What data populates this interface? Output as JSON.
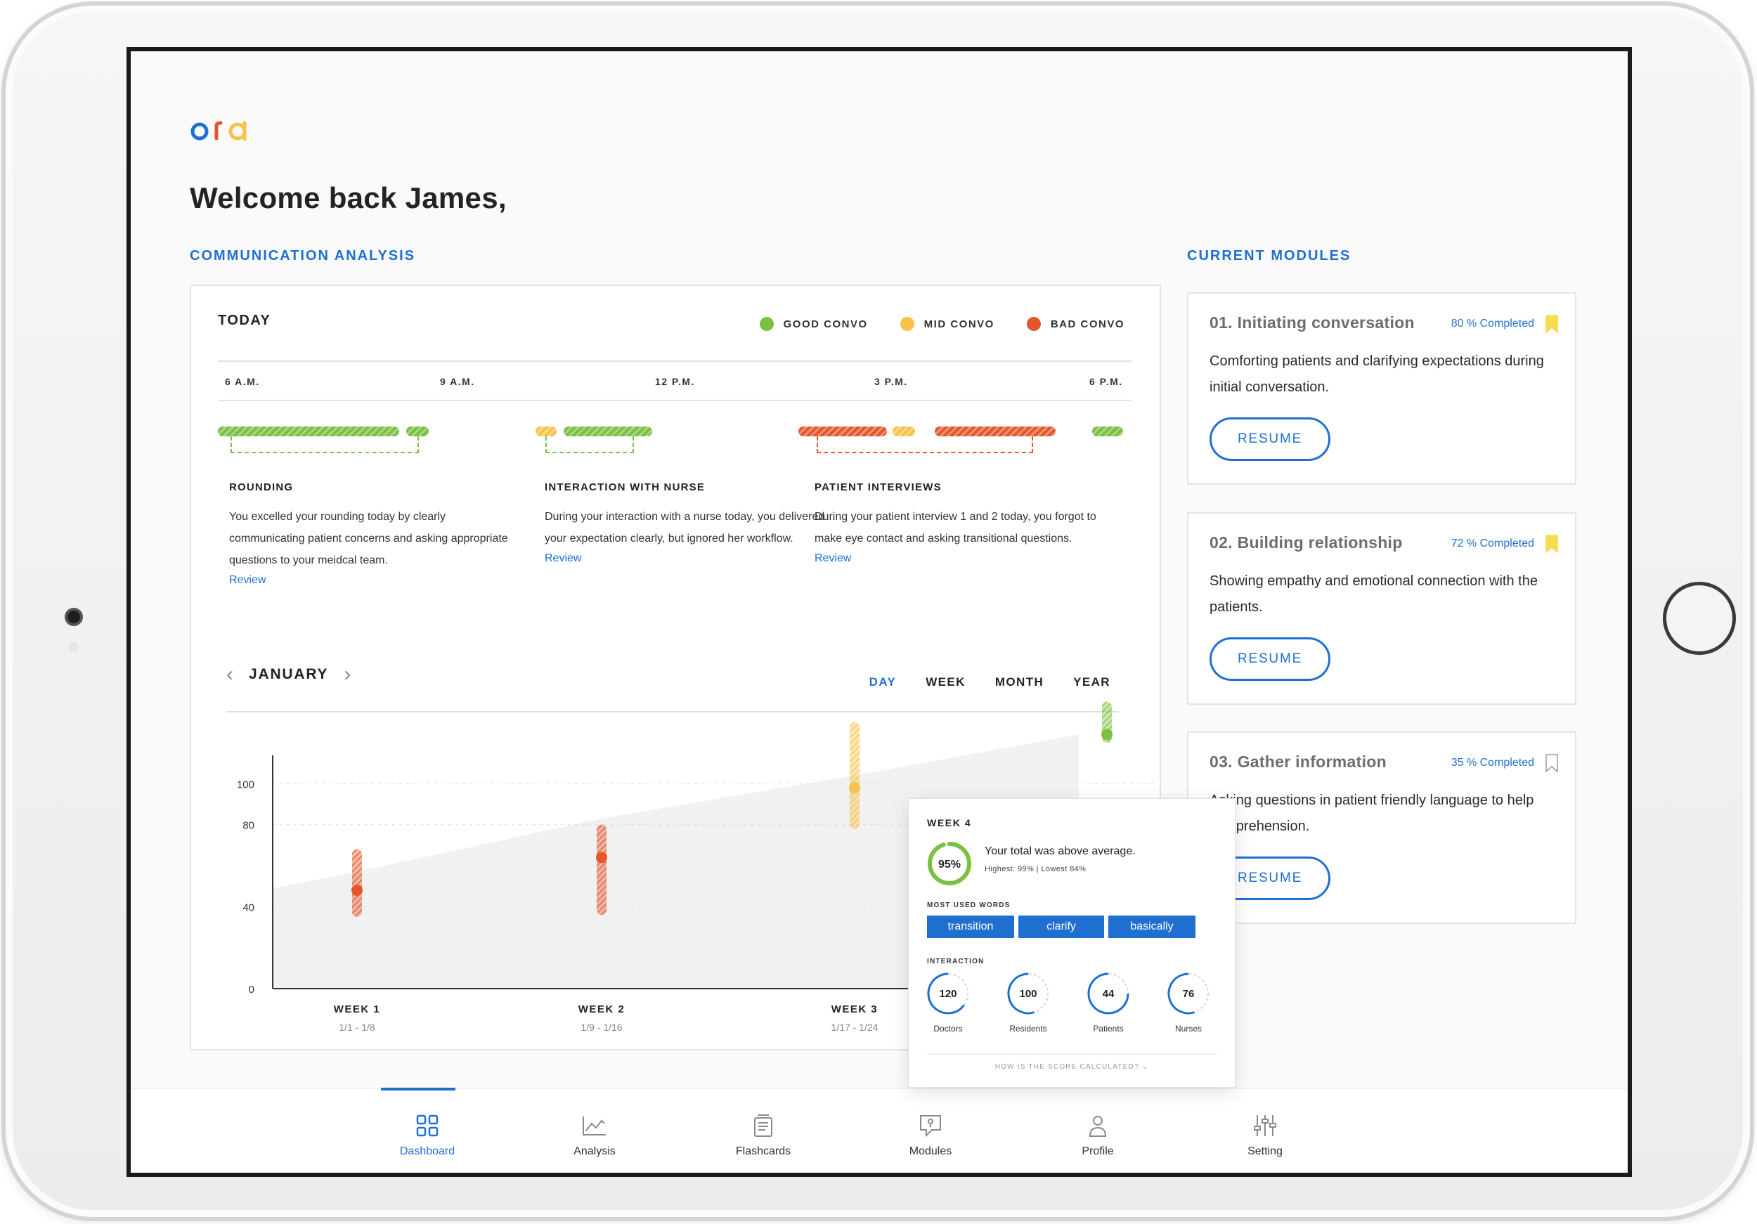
{
  "brand": {
    "logo": "ora",
    "logo_colors": [
      "#1f6fd1",
      "#e3572a",
      "#f6c24b"
    ]
  },
  "header": {
    "welcome": "Welcome back James,"
  },
  "sections": {
    "analysis": "COMMUNICATION ANALYSIS",
    "modules": "CURRENT MODULES"
  },
  "today": {
    "label": "TODAY",
    "legend": [
      {
        "label": "GOOD CONVO",
        "color": "#79c043"
      },
      {
        "label": "MID CONVO",
        "color": "#f6c24b"
      },
      {
        "label": "BAD CONVO",
        "color": "#e3572a"
      }
    ],
    "ticks": [
      "6 A.M.",
      "9 A.M.",
      "12 P.M.",
      "3 P.M.",
      "6 P.M."
    ],
    "events": [
      {
        "title": "ROUNDING",
        "text": "You excelled your rounding today by clearly communicating patient concerns and asking appropriate questions to your meidcal team.",
        "link": "Review"
      },
      {
        "title": "INTERACTION WITH NURSE",
        "text": "During your interaction with a nurse today, you delivered your expectation clearly, but ignored her workflow.",
        "link": "Review"
      },
      {
        "title": "PATIENT INTERVIEWS",
        "text": "During your patient interview 1 and 2 today, you forgot to make eye contact and asking transitional questions.",
        "link": "Review"
      }
    ]
  },
  "period": {
    "month": "JANUARY",
    "tabs": [
      "DAY",
      "WEEK",
      "MONTH",
      "YEAR"
    ],
    "active_tab": "DAY"
  },
  "chart_data": {
    "type": "line",
    "categories": [
      "WEEK 1",
      "WEEK 2",
      "WEEK 3",
      "WEEK 4"
    ],
    "date_ranges": [
      "1/1 - 1/8",
      "1/9 - 1/16",
      "1/17 - 1/24",
      ""
    ],
    "y_ticks": [
      0,
      40,
      80,
      100
    ],
    "ylim": [
      0,
      120
    ],
    "values": [
      48,
      64,
      98,
      124
    ],
    "ranges": [
      [
        35,
        68
      ],
      [
        36,
        80
      ],
      [
        78,
        130
      ],
      [
        120,
        140
      ]
    ],
    "point_colors": [
      "#e3572a",
      "#e3572a",
      "#f6c24b",
      "#79c043"
    ],
    "average_area": [
      49,
      57,
      83,
      104,
      124
    ]
  },
  "popover": {
    "week": "WEEK 4",
    "score": "95%",
    "score_value": 95,
    "summary": "Your total was above average.",
    "range": "Highest: 99%  |  Lowest 84%",
    "words_label": "MOST USED WORDS",
    "words": [
      "transition",
      "clarify",
      "basically"
    ],
    "interaction_label": "INTERACTION",
    "interactions": [
      {
        "count": "120",
        "label": "Doctors",
        "fill": 0.35
      },
      {
        "count": "100",
        "label": "Residents",
        "fill": 0.45
      },
      {
        "count": "44",
        "label": "Patients",
        "fill": 0.25
      },
      {
        "count": "76",
        "label": "Nurses",
        "fill": 0.45
      }
    ],
    "footer": "HOW IS THE SCORE CALCULATED?"
  },
  "modules": [
    {
      "title": "01. Initiating conversation",
      "progress": "80 % Completed",
      "bookmarked": true,
      "desc": "Comforting patients and clarifying expectations during initial conversation.",
      "button": "RESUME"
    },
    {
      "title": "02. Building relationship",
      "progress": "72 % Completed",
      "bookmarked": true,
      "desc": "Showing empathy and emotional connection with the patients.",
      "button": "RESUME"
    },
    {
      "title": "03. Gather information",
      "progress": "35 % Completed",
      "bookmarked": false,
      "desc": "Asking questions in patient friendly language to help comprehension.",
      "button": "RESUME"
    }
  ],
  "nav": {
    "items": [
      {
        "label": "Dashboard",
        "icon": "grid-icon"
      },
      {
        "label": "Analysis",
        "icon": "chart-icon"
      },
      {
        "label": "Flashcards",
        "icon": "flashcards-icon"
      },
      {
        "label": "Modules",
        "icon": "modules-icon"
      },
      {
        "label": "Profile",
        "icon": "profile-icon"
      },
      {
        "label": "Setting",
        "icon": "sliders-icon"
      }
    ],
    "active": "Dashboard"
  },
  "colors": {
    "accent": "#1f6fd1",
    "good": "#79c043",
    "mid": "#f6c24b",
    "bad": "#e3572a"
  }
}
